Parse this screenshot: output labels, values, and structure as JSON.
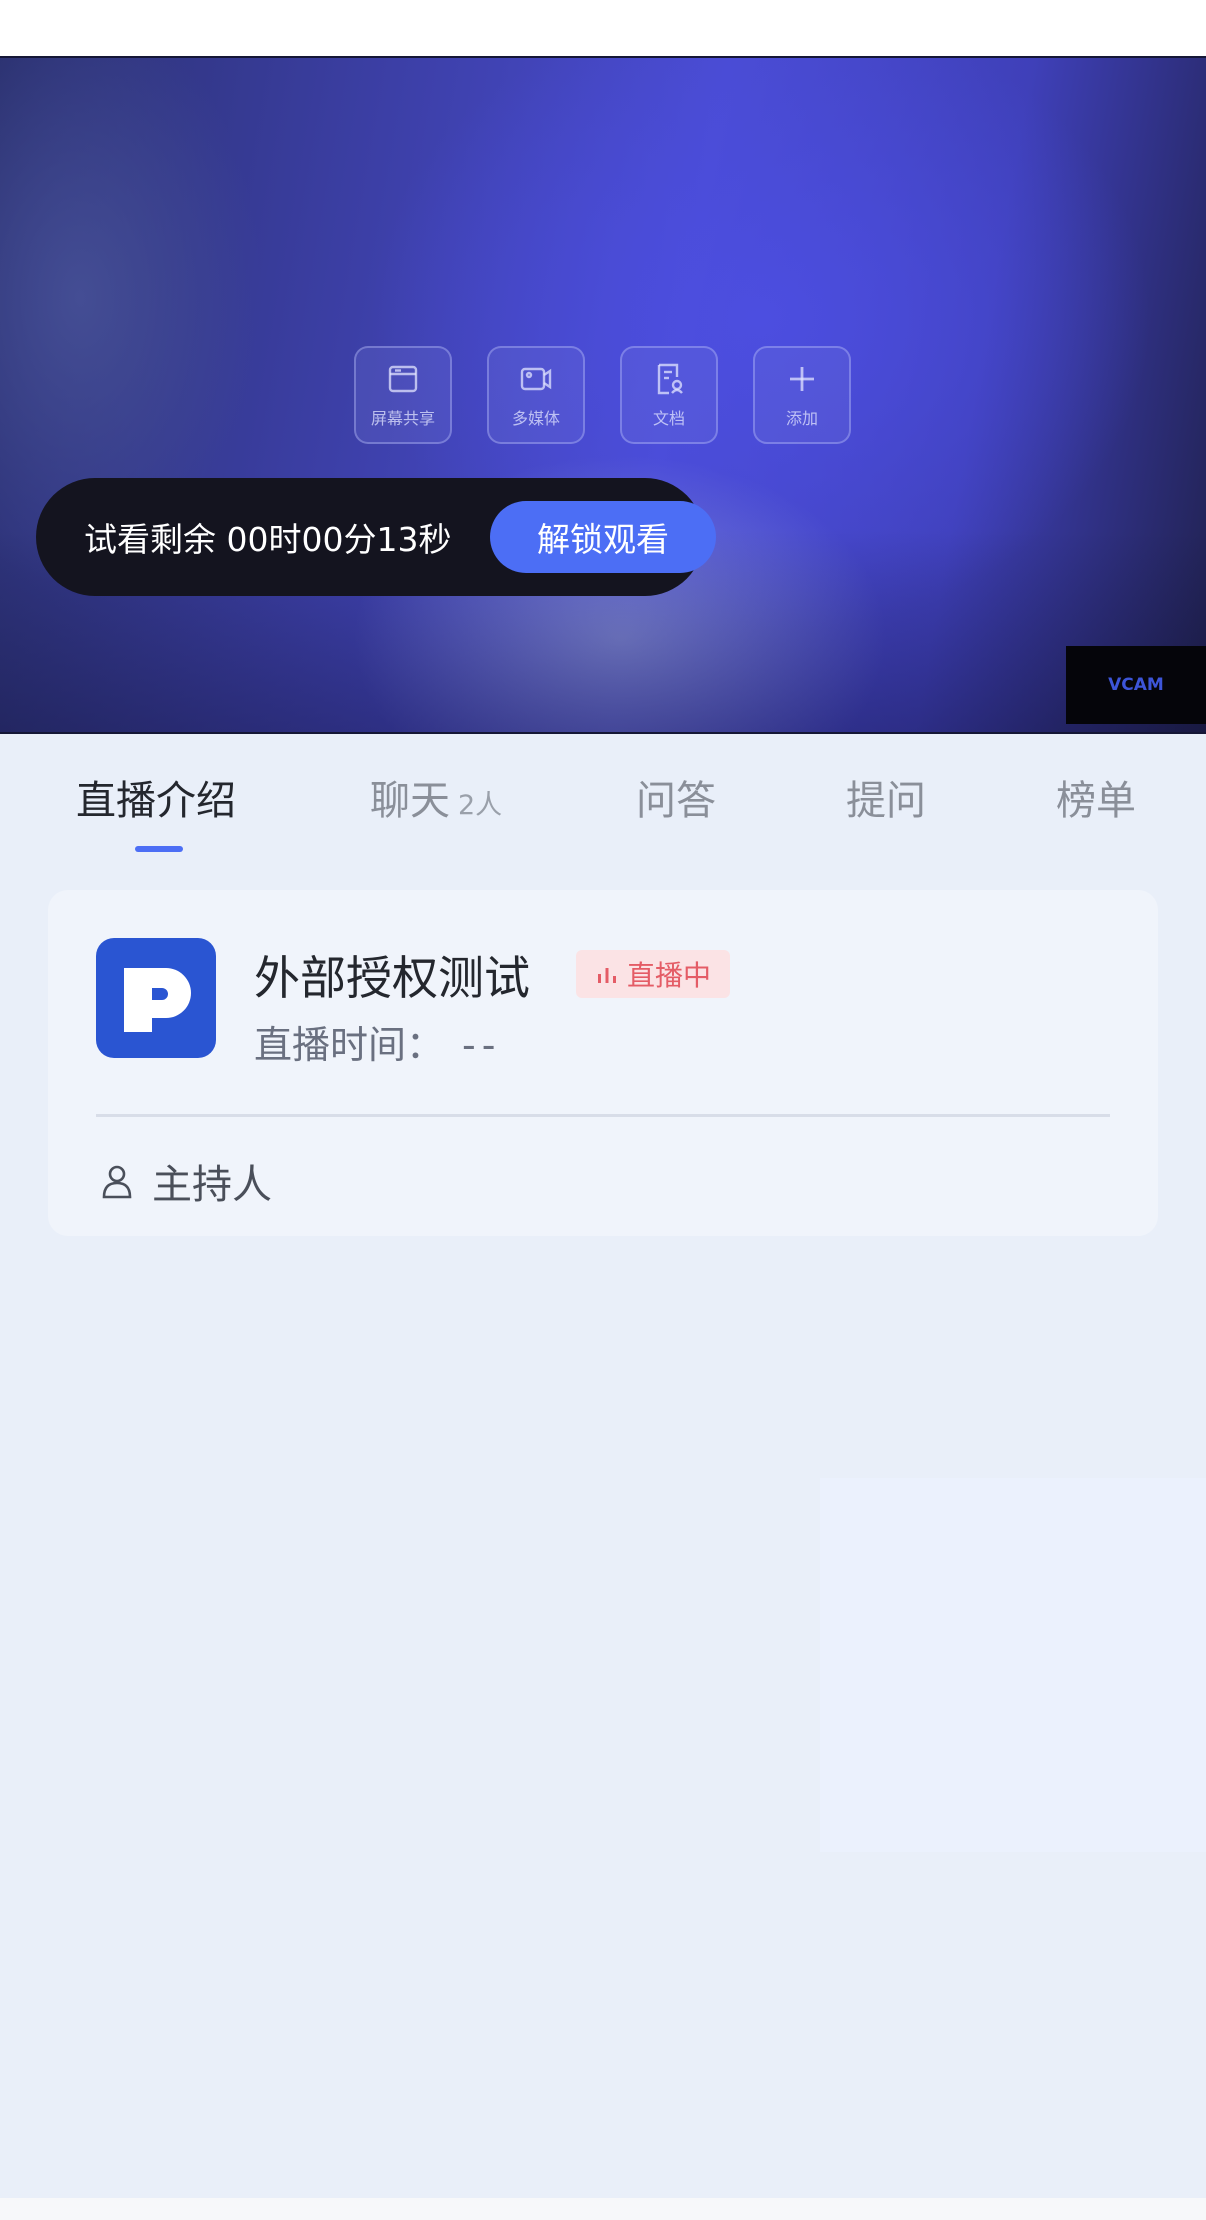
{
  "colors": {
    "accent": "#4c6ef5",
    "live": "#e45c66",
    "background": "#e9eff9",
    "card": "#f0f4fb"
  },
  "player": {
    "tools": [
      {
        "icon": "screen-share-icon",
        "label": "屏幕共享"
      },
      {
        "icon": "multimedia-icon",
        "label": "多媒体"
      },
      {
        "icon": "document-icon",
        "label": "文档"
      },
      {
        "icon": "plus-icon",
        "label": "添加"
      }
    ],
    "trial_text": "试看剩余 00时00分13秒",
    "unlock_label": "解锁观看",
    "watermark": "VCAM"
  },
  "tabs": [
    {
      "label": "直播介绍",
      "active": true
    },
    {
      "label": "聊天",
      "sub": "2人"
    },
    {
      "label": "问答"
    },
    {
      "label": "提问"
    },
    {
      "label": "榜单"
    }
  ],
  "card": {
    "logo_icon": "p-logo-icon",
    "title": "外部授权测试",
    "live_badge": "直播中",
    "time_label": "直播时间：",
    "time_value": "--",
    "host_label": "主持人"
  }
}
